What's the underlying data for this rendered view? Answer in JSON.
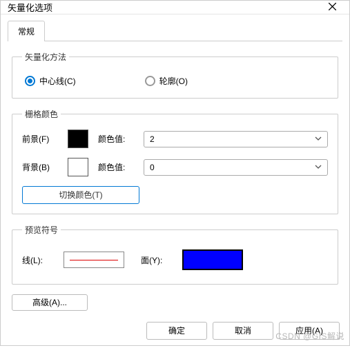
{
  "window": {
    "title": "矢量化选项"
  },
  "tabs": {
    "general": "常规"
  },
  "method": {
    "legend": "矢量化方法",
    "centerline": "中心线(C)",
    "outline": "轮廓(O)",
    "selected": "centerline"
  },
  "rasterColor": {
    "legend": "栅格颜色",
    "foreground": "前景(F)",
    "background": "背景(B)",
    "colorValueLabel": "颜色值:",
    "fgValue": "2",
    "bgValue": "0",
    "fgSwatch": "#000000",
    "bgSwatch": "#ffffff",
    "switchColors": "切换颜色(T)"
  },
  "preview": {
    "legend": "预览符号",
    "lineLabel": "线(L):",
    "faceLabel": "面(Y):",
    "lineColor": "#dd0000",
    "faceColor": "#0000ff"
  },
  "advanced": "高级(A)...",
  "footer": {
    "ok": "确定",
    "cancel": "取消",
    "apply": "应用(A)"
  },
  "watermark": "CSDN @GIS解说"
}
